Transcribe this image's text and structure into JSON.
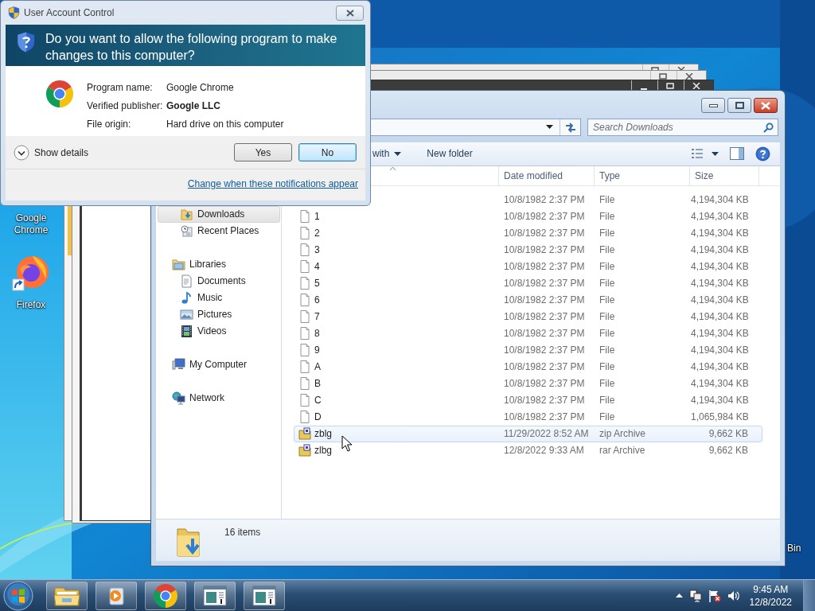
{
  "desktop": {
    "icons": [
      {
        "label": "Google Chrome"
      },
      {
        "label": "Firefox",
        "kind": "firefox"
      },
      {
        "label": "Bin"
      }
    ]
  },
  "uac": {
    "title": "User Account Control",
    "question": "Do you want to allow the following program to make changes to this computer?",
    "details": [
      {
        "label": "Program name:",
        "value": "Google Chrome",
        "bold": false
      },
      {
        "label": "Verified publisher:",
        "value": "Google LLC",
        "bold": true
      },
      {
        "label": "File origin:",
        "value": "Hard drive on this computer",
        "bold": false
      }
    ],
    "show_details": "Show details",
    "buttons": [
      {
        "label": "Yes",
        "default": false
      },
      {
        "label": "No",
        "default": true
      }
    ],
    "link": "Change when these notifications appear"
  },
  "explorer": {
    "search": {
      "placeholder": "Search Downloads"
    },
    "toolbar": [
      {
        "label": "with",
        "dropdown": true
      },
      {
        "label": "New folder",
        "dropdown": false
      }
    ],
    "nav_pane": {
      "sections": [
        {
          "items": [
            {
              "label": "Downloads",
              "kind": "downloads",
              "selected": true
            },
            {
              "label": "Recent Places",
              "kind": "recent",
              "selected": false
            }
          ]
        },
        {
          "header": {
            "label": "Libraries",
            "kind": "library",
            "selected": false
          },
          "items": [
            {
              "label": "Documents",
              "kind": "documents",
              "selected": false
            },
            {
              "label": "Music",
              "kind": "music",
              "selected": false
            },
            {
              "label": "Pictures",
              "kind": "pictures",
              "selected": false
            },
            {
              "label": "Videos",
              "kind": "videos",
              "selected": false
            }
          ]
        },
        {
          "header": {
            "label": "My Computer",
            "kind": "computer",
            "selected": false
          }
        },
        {
          "header": {
            "label": "Network",
            "kind": "network",
            "selected": false
          }
        }
      ]
    },
    "table": {
      "columns": [
        {
          "sorted": true
        },
        {
          "label": "Date modified",
          "sorted": false
        },
        {
          "label": "Type",
          "sorted": false
        },
        {
          "label": "Size",
          "sorted": false
        }
      ],
      "rows": [
        {
          "date": "10/8/1982 2:37 PM",
          "type": "File",
          "size": "4,194,304 KB",
          "hovered": false
        },
        {
          "name": "1",
          "kind": "file",
          "date": "10/8/1982 2:37 PM",
          "type": "File",
          "size": "4,194,304 KB",
          "hovered": false
        },
        {
          "name": "2",
          "kind": "file",
          "date": "10/8/1982 2:37 PM",
          "type": "File",
          "size": "4,194,304 KB",
          "hovered": false
        },
        {
          "name": "3",
          "kind": "file",
          "date": "10/8/1982 2:37 PM",
          "type": "File",
          "size": "4,194,304 KB",
          "hovered": false
        },
        {
          "name": "4",
          "kind": "file",
          "date": "10/8/1982 2:37 PM",
          "type": "File",
          "size": "4,194,304 KB",
          "hovered": false
        },
        {
          "name": "5",
          "kind": "file",
          "date": "10/8/1982 2:37 PM",
          "type": "File",
          "size": "4,194,304 KB",
          "hovered": false
        },
        {
          "name": "6",
          "kind": "file",
          "date": "10/8/1982 2:37 PM",
          "type": "File",
          "size": "4,194,304 KB",
          "hovered": false
        },
        {
          "name": "7",
          "kind": "file",
          "date": "10/8/1982 2:37 PM",
          "type": "File",
          "size": "4,194,304 KB",
          "hovered": false
        },
        {
          "name": "8",
          "kind": "file",
          "date": "10/8/1982 2:37 PM",
          "type": "File",
          "size": "4,194,304 KB",
          "hovered": false
        },
        {
          "name": "9",
          "kind": "file",
          "date": "10/8/1982 2:37 PM",
          "type": "File",
          "size": "4,194,304 KB",
          "hovered": false
        },
        {
          "name": "A",
          "kind": "file",
          "date": "10/8/1982 2:37 PM",
          "type": "File",
          "size": "4,194,304 KB",
          "hovered": false
        },
        {
          "name": "B",
          "kind": "file",
          "date": "10/8/1982 2:37 PM",
          "type": "File",
          "size": "4,194,304 KB",
          "hovered": false
        },
        {
          "name": "C",
          "kind": "file",
          "date": "10/8/1982 2:37 PM",
          "type": "File",
          "size": "4,194,304 KB",
          "hovered": false
        },
        {
          "name": "D",
          "kind": "file",
          "date": "10/8/1982 2:37 PM",
          "type": "File",
          "size": "1,065,984 KB",
          "hovered": false
        },
        {
          "name": "zblg",
          "kind": "zip",
          "date": "11/29/2022 8:52 AM",
          "type": "zip Archive",
          "size": "9,662 KB",
          "hovered": true
        },
        {
          "name": "zlbg",
          "kind": "rar",
          "date": "12/8/2022 9:33 AM",
          "type": "rar Archive",
          "size": "9,662 KB",
          "hovered": false
        }
      ]
    },
    "status": "16 items"
  },
  "taskbar": {
    "buttons": [
      {
        "kind": "explorer"
      },
      {
        "kind": "media"
      },
      {
        "kind": "chrome"
      },
      {
        "kind": "window"
      },
      {
        "kind": "window"
      }
    ],
    "clock": {
      "time": "9:45 AM",
      "date": "12/8/2022"
    }
  }
}
